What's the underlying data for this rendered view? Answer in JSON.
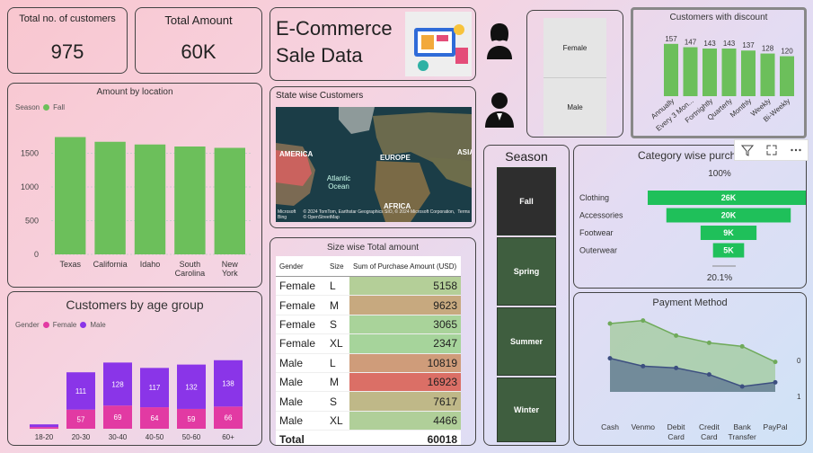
{
  "kpis": {
    "customers": {
      "label": "Total no. of customers",
      "value": "975"
    },
    "amount": {
      "label": "Total Amount",
      "value": "60K"
    }
  },
  "header": {
    "title_line1": "E-Commerce",
    "title_line2": "Sale Data"
  },
  "gender_slicer": {
    "female": "Female",
    "male": "Male"
  },
  "season_slicer": {
    "title": "Season",
    "items": [
      "Fall",
      "Spring",
      "Summer",
      "Winter"
    ]
  },
  "location_chart": {
    "title": "Amount by location",
    "legend_title": "Season",
    "legend_item": "Fall",
    "legend_color": "#6cbf5b",
    "chart_data": {
      "type": "bar",
      "categories": [
        "Texas",
        "California",
        "Idaho",
        "South Carolina",
        "New York"
      ],
      "values": [
        1740,
        1670,
        1630,
        1600,
        1580
      ],
      "ylim": [
        0,
        2000
      ],
      "yticks": [
        0,
        500,
        1000,
        1500
      ]
    }
  },
  "age_chart": {
    "title": "Customers by age group",
    "legend_title": "Gender",
    "series_names": [
      "Female",
      "Male"
    ],
    "colors": {
      "female": "#e23aa3",
      "male": "#8a35e8"
    },
    "chart_data": {
      "type": "bar",
      "stacked": true,
      "categories": [
        "18-20",
        "20-30",
        "30-40",
        "40-50",
        "50-60",
        "60+"
      ],
      "series": [
        {
          "name": "Female",
          "values": [
            5,
            57,
            69,
            64,
            59,
            66
          ]
        },
        {
          "name": "Male",
          "values": [
            8,
            111,
            128,
            117,
            132,
            138
          ]
        }
      ],
      "labels_female": [
        "",
        "57",
        "69",
        "64",
        "59",
        "66"
      ],
      "labels_male": [
        "",
        "111",
        "128",
        "117",
        "132",
        "138"
      ]
    }
  },
  "map": {
    "title": "State wise Customers",
    "labels": {
      "america": "AMERICA",
      "europe": "EUROPE",
      "asia": "ASIA",
      "africa": "AFRICA",
      "ocean": "Atlantic Ocean"
    },
    "attribution": "© 2024 TomTom, Earthstar Geographics SIO, © 2024 Microsoft Corporation, © OpenStreetMap",
    "terms": "Terms",
    "brand": "Microsoft Bing"
  },
  "size_table": {
    "title": "Size wise Total amount",
    "headers": [
      "Gender",
      "Size",
      "Sum of Purchase Amount (USD)"
    ],
    "rows": [
      {
        "gender": "Female",
        "size": "L",
        "amount": "5158",
        "color": "#b4cf98"
      },
      {
        "gender": "Female",
        "size": "M",
        "amount": "9623",
        "color": "#c7a97f"
      },
      {
        "gender": "Female",
        "size": "S",
        "amount": "3065",
        "color": "#a9d39a"
      },
      {
        "gender": "Female",
        "size": "XL",
        "amount": "2347",
        "color": "#a6d49b"
      },
      {
        "gender": "Male",
        "size": "L",
        "amount": "10819",
        "color": "#cf9c7a"
      },
      {
        "gender": "Male",
        "size": "M",
        "amount": "16923",
        "color": "#db6f66"
      },
      {
        "gender": "Male",
        "size": "S",
        "amount": "7617",
        "color": "#bfb888"
      },
      {
        "gender": "Male",
        "size": "XL",
        "amount": "4466",
        "color": "#b0cf99"
      }
    ],
    "total_label": "Total",
    "total_value": "60018"
  },
  "discount_chart": {
    "title": "Customers with discount",
    "bar_color": "#6cbf5b",
    "chart_data": {
      "type": "bar",
      "categories": [
        "Annually",
        "Every 3 Mon...",
        "Fortnightly",
        "Quarterly",
        "Monthly",
        "Weekly",
        "Bi-Weekly"
      ],
      "values": [
        157,
        147,
        143,
        143,
        137,
        128,
        120
      ],
      "ylim": [
        0,
        170
      ]
    }
  },
  "category_chart": {
    "title": "Category wise purcha",
    "top_label": "100%",
    "bottom_label": "20.1%",
    "bar_color": "#1fc05a",
    "chart_data": {
      "type": "funnel",
      "categories": [
        "Clothing",
        "Accessories",
        "Footwear",
        "Outerwear"
      ],
      "values": [
        26,
        20,
        9,
        5
      ],
      "labels": [
        "26K",
        "20K",
        "9K",
        "5K"
      ]
    }
  },
  "payment_chart": {
    "title": "Payment Method",
    "right_labels": [
      "0",
      "1"
    ],
    "colors": {
      "upper": "#8dc27a",
      "lower": "#4a5e8a"
    },
    "chart_data": {
      "type": "area",
      "categories": [
        "Cash",
        "Venmo",
        "Debit Card",
        "Credit Card",
        "Bank Transfer",
        "PayPal"
      ],
      "series": [
        {
          "values": [
            0.88,
            0.93,
            0.68,
            0.56,
            0.5,
            0.24
          ]
        },
        {
          "values": [
            0.3,
            0.17,
            0.14,
            0.03,
            -0.17,
            -0.1
          ]
        }
      ]
    }
  },
  "toolbar": {
    "filter": "filter-icon",
    "focus": "focus-icon",
    "more": "more-icon"
  }
}
